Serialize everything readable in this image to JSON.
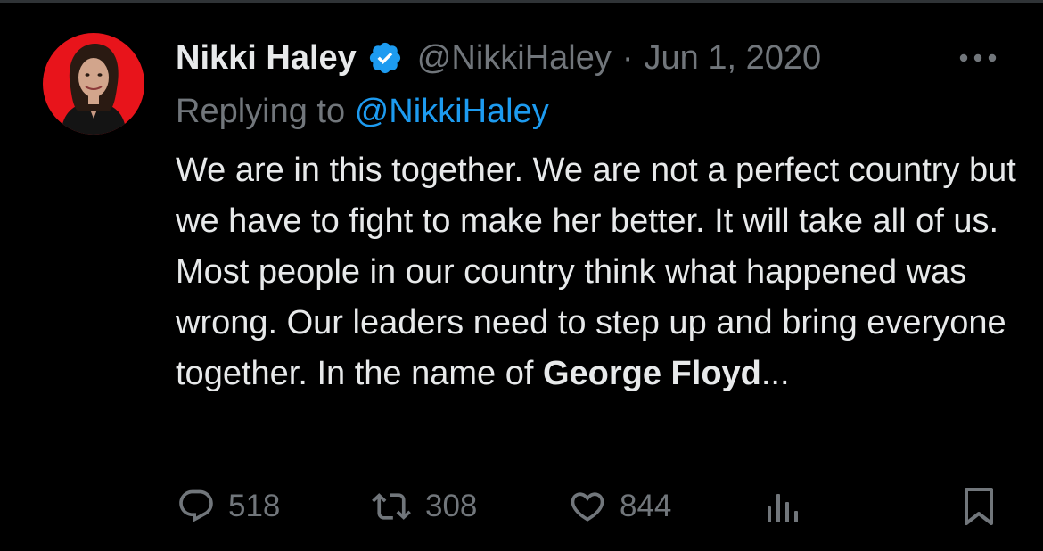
{
  "tweet": {
    "author": {
      "display_name": "Nikki Haley",
      "handle": "@NikkiHaley",
      "verified": true,
      "avatar_background": "#e8141b"
    },
    "separator": "·",
    "date": "Jun 1, 2020",
    "replying_prefix": "Replying to",
    "replying_to": "@NikkiHaley",
    "text_before_bold": "We are in this together. We are not a perfect country but we have to fight to make her better. It will take all of us. Most people in our country think what happened was wrong. Our leaders need to step up and bring everyone together. In the name of ",
    "text_bold": "George Floyd",
    "text_after_bold": "...",
    "actions": {
      "reply_count": "518",
      "retweet_count": "308",
      "like_count": "844"
    }
  },
  "icons": {
    "verified": "verified-badge-icon",
    "more": "more-options-icon",
    "reply": "reply-bubble-icon",
    "retweet": "retweet-arrows-icon",
    "like": "heart-icon",
    "views": "views-bar-chart-icon",
    "bookmark": "bookmark-icon"
  },
  "colors": {
    "background": "#000000",
    "primary_text": "#e7e9ea",
    "secondary_text": "#71767b",
    "accent": "#1d9bf0"
  }
}
